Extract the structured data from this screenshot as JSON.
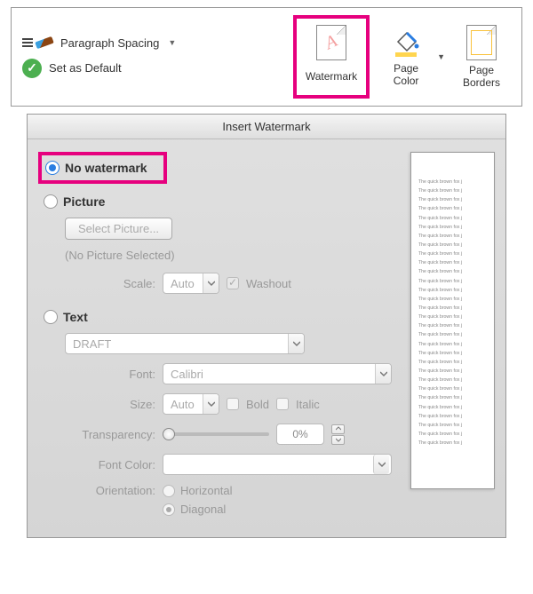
{
  "ribbon": {
    "paragraph_spacing": "Paragraph Spacing",
    "set_as_default": "Set as Default",
    "watermark": "Watermark",
    "page_color": "Page\nColor",
    "page_borders": "Page\nBorders"
  },
  "dialog": {
    "title": "Insert Watermark",
    "no_watermark": "No watermark",
    "picture": "Picture",
    "select_picture_btn": "Select Picture...",
    "no_picture_selected": "(No Picture Selected)",
    "scale_label": "Scale:",
    "scale_value": "Auto",
    "washout": "Washout",
    "text": "Text",
    "text_value": "DRAFT",
    "font_label": "Font:",
    "font_value": "Calibri",
    "size_label": "Size:",
    "size_value": "Auto",
    "bold": "Bold",
    "italic": "Italic",
    "transparency_label": "Transparency:",
    "transparency_value": "0%",
    "font_color_label": "Font Color:",
    "orientation_label": "Orientation:",
    "horizontal": "Horizontal",
    "diagonal": "Diagonal"
  },
  "preview": {
    "line_text": "The quick brown fox j",
    "line_count": 30
  }
}
